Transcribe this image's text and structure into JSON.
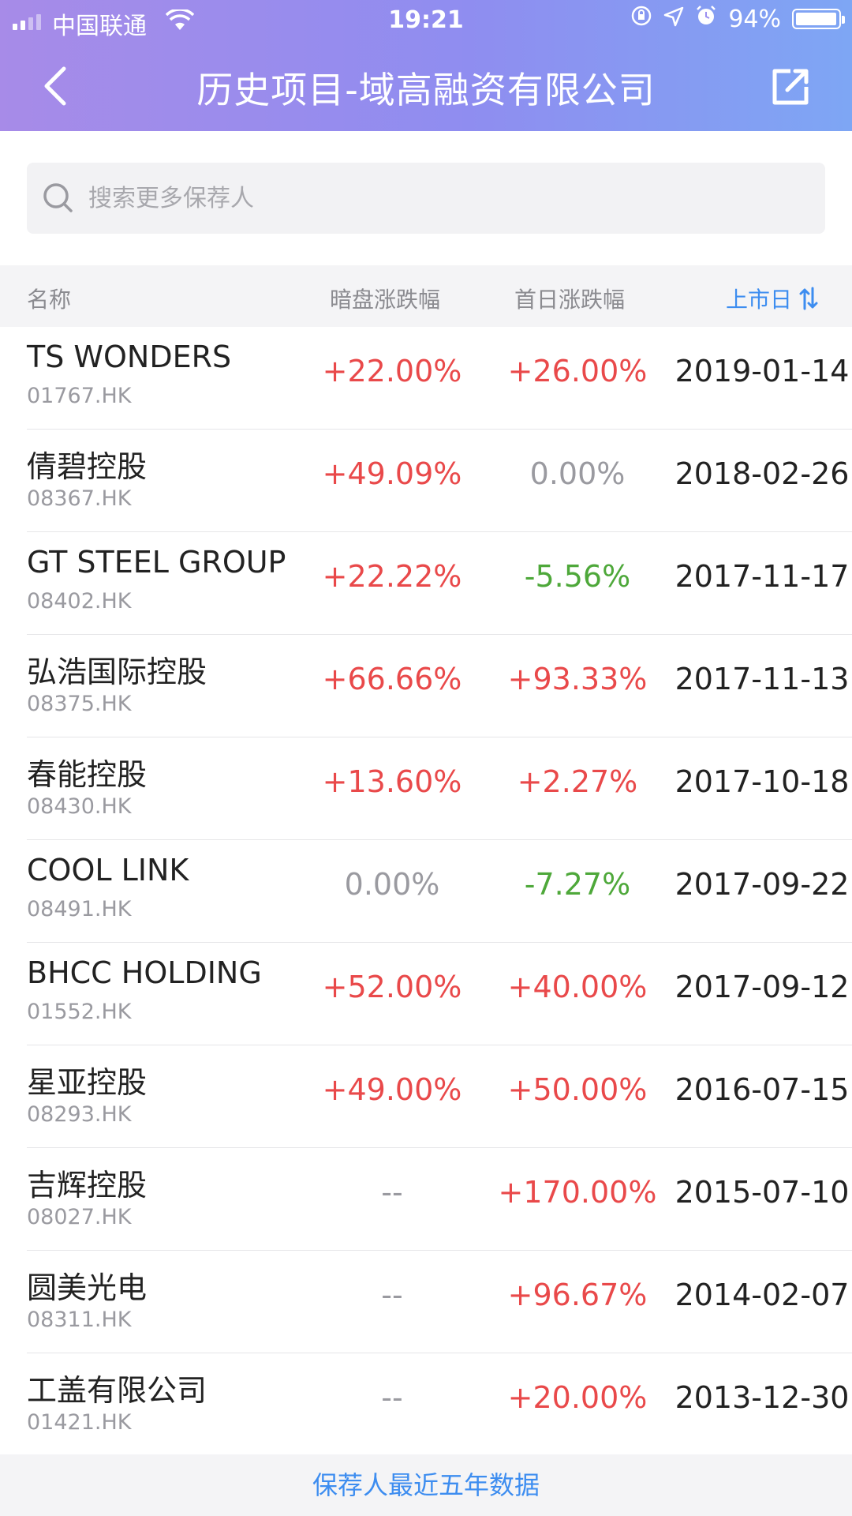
{
  "status_bar": {
    "carrier": "中国联通",
    "time": "19:21",
    "battery": "94%",
    "battery_level": 0.94
  },
  "nav": {
    "title": "历史项目-域高融资有限公司"
  },
  "search": {
    "placeholder": "搜索更多保荐人",
    "value": ""
  },
  "table": {
    "headers": {
      "name": "名称",
      "dark_pool": "暗盘涨跌幅",
      "first_day": "首日涨跌幅",
      "listing_date": "上市日"
    },
    "rows": [
      {
        "name": "TS WONDERS",
        "code": "01767.HK",
        "dark": "+22.00%",
        "dark_trend": "up",
        "first": "+26.00%",
        "first_trend": "up",
        "date": "2019-01-14"
      },
      {
        "name": "倩碧控股",
        "code": "08367.HK",
        "dark": "+49.09%",
        "dark_trend": "up",
        "first": "0.00%",
        "first_trend": "flat",
        "date": "2018-02-26"
      },
      {
        "name": "GT STEEL GROUP",
        "code": "08402.HK",
        "dark": "+22.22%",
        "dark_trend": "up",
        "first": "-5.56%",
        "first_trend": "down",
        "date": "2017-11-17"
      },
      {
        "name": "弘浩国际控股",
        "code": "08375.HK",
        "dark": "+66.66%",
        "dark_trend": "up",
        "first": "+93.33%",
        "first_trend": "up",
        "date": "2017-11-13"
      },
      {
        "name": "春能控股",
        "code": "08430.HK",
        "dark": "+13.60%",
        "dark_trend": "up",
        "first": "+2.27%",
        "first_trend": "up",
        "date": "2017-10-18"
      },
      {
        "name": "COOL LINK",
        "code": "08491.HK",
        "dark": "0.00%",
        "dark_trend": "flat",
        "first": "-7.27%",
        "first_trend": "down",
        "date": "2017-09-22"
      },
      {
        "name": "BHCC HOLDING",
        "code": "01552.HK",
        "dark": "+52.00%",
        "dark_trend": "up",
        "first": "+40.00%",
        "first_trend": "up",
        "date": "2017-09-12"
      },
      {
        "name": "星亚控股",
        "code": "08293.HK",
        "dark": "+49.00%",
        "dark_trend": "up",
        "first": "+50.00%",
        "first_trend": "up",
        "date": "2016-07-15"
      },
      {
        "name": "吉辉控股",
        "code": "08027.HK",
        "dark": "--",
        "dark_trend": "flat",
        "first": "+170.00%",
        "first_trend": "up",
        "date": "2015-07-10"
      },
      {
        "name": "圆美光电",
        "code": "08311.HK",
        "dark": "--",
        "dark_trend": "flat",
        "first": "+96.67%",
        "first_trend": "up",
        "date": "2014-02-07"
      },
      {
        "name": "工盖有限公司",
        "code": "01421.HK",
        "dark": "--",
        "dark_trend": "flat",
        "first": "+20.00%",
        "first_trend": "up",
        "date": "2013-12-30"
      }
    ]
  },
  "footer": {
    "label": "保荐人最近五年数据"
  },
  "colors": {
    "up": "#e9494a",
    "down": "#4ea83a",
    "flat": "#9a9aa0",
    "accent": "#3d8df0"
  },
  "icons": {
    "back": "chevron-left-icon",
    "share": "share-icon",
    "search": "search-icon",
    "sort": "sort-arrows-icon"
  }
}
